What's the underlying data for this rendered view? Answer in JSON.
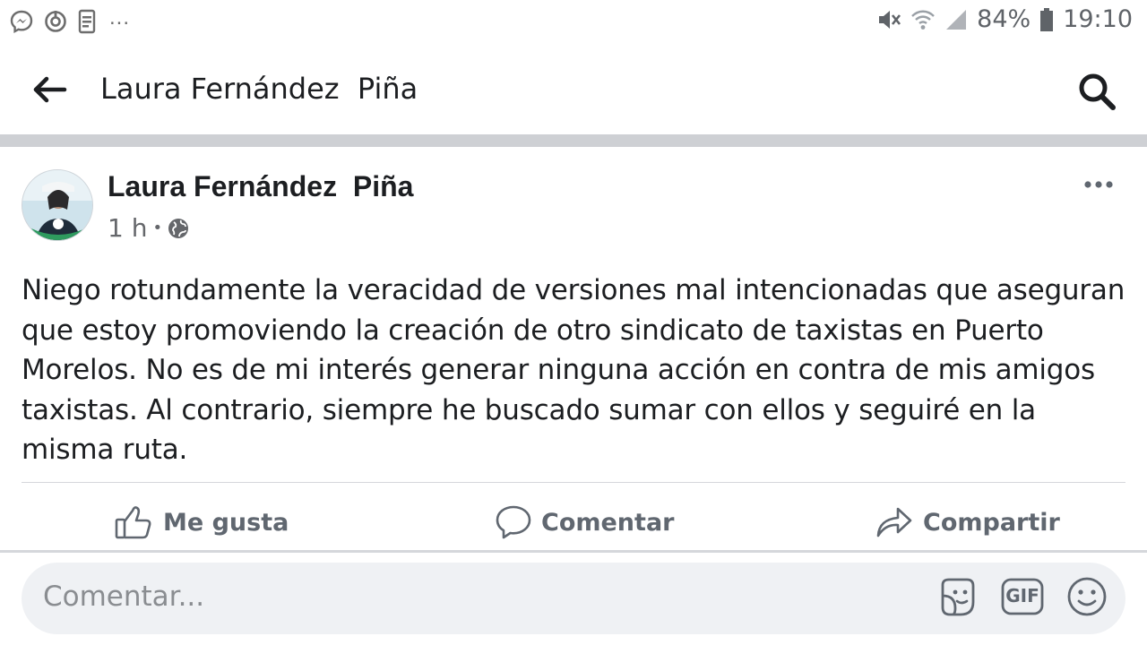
{
  "status_bar": {
    "notification_icons": [
      "messenger-icon",
      "sync-icon",
      "clipboard-icon"
    ],
    "more_indicator": "...",
    "battery": "84%",
    "time": "19:10",
    "system_icons": [
      "mute-icon",
      "wifi-icon",
      "signal-icon",
      "battery-icon"
    ]
  },
  "header": {
    "title": "Laura Fernández  Piña"
  },
  "post": {
    "author": "Laura Fernández  Piña",
    "time": "1 h",
    "separator": "•",
    "audience_icon": "globe-icon",
    "text": "Niego rotundamente la veracidad de versiones mal intencionadas que aseguran que estoy promoviendo la creación de otro sindicato de taxistas en Puerto Morelos. No es de mi interés generar ninguna acción en contra de mis amigos taxistas. Al contrario, siempre he buscado sumar con ellos y seguiré en la misma ruta."
  },
  "actions": {
    "like": "Me gusta",
    "comment": "Comentar",
    "share": "Compartir"
  },
  "comment_box": {
    "placeholder": "Comentar...",
    "gif_label": "GIF"
  },
  "colors": {
    "text_primary": "#1c1e21",
    "text_secondary": "#65676b",
    "action_gray": "#606770",
    "divider": "#ced0d4",
    "input_bg": "#eff1f4"
  }
}
